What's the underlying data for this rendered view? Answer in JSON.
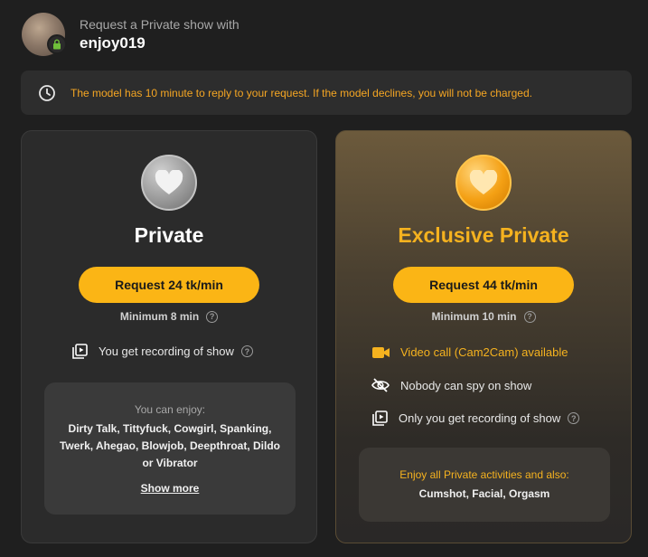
{
  "header": {
    "subtitle": "Request a Private show with",
    "username": "enjoy019"
  },
  "notice": {
    "text": "The model has 10 minute to reply to your request. If the model declines, you will not be charged."
  },
  "private": {
    "title": "Private",
    "button_label": "Request 24 tk/min",
    "minimum": "Minimum 8 min",
    "features": [
      "You get recording of show"
    ],
    "enjoy_heading": "You can enjoy:",
    "enjoy_items": "Dirty Talk, Tittyfuck, Cowgirl, Spanking, Twerk, Ahegao, Blowjob, Deepthroat, Dildo or Vibrator",
    "show_more": "Show more"
  },
  "exclusive": {
    "title": "Exclusive Private",
    "button_label": "Request 44 tk/min",
    "minimum": "Minimum 10 min",
    "features": [
      "Video call (Cam2Cam) available",
      "Nobody can spy on show",
      "Only you get recording of show"
    ],
    "enjoy_heading": "Enjoy all Private activities and also:",
    "enjoy_items": "Cumshot, Facial, Orgasm"
  },
  "colors": {
    "accent": "#fbb515",
    "gold_text": "#f5b21f",
    "background": "#1f1f1f"
  },
  "icons": [
    "lock-icon",
    "clock-icon",
    "heart-icon",
    "recording-icon",
    "video-camera-icon",
    "eye-off-icon",
    "help-icon"
  ]
}
